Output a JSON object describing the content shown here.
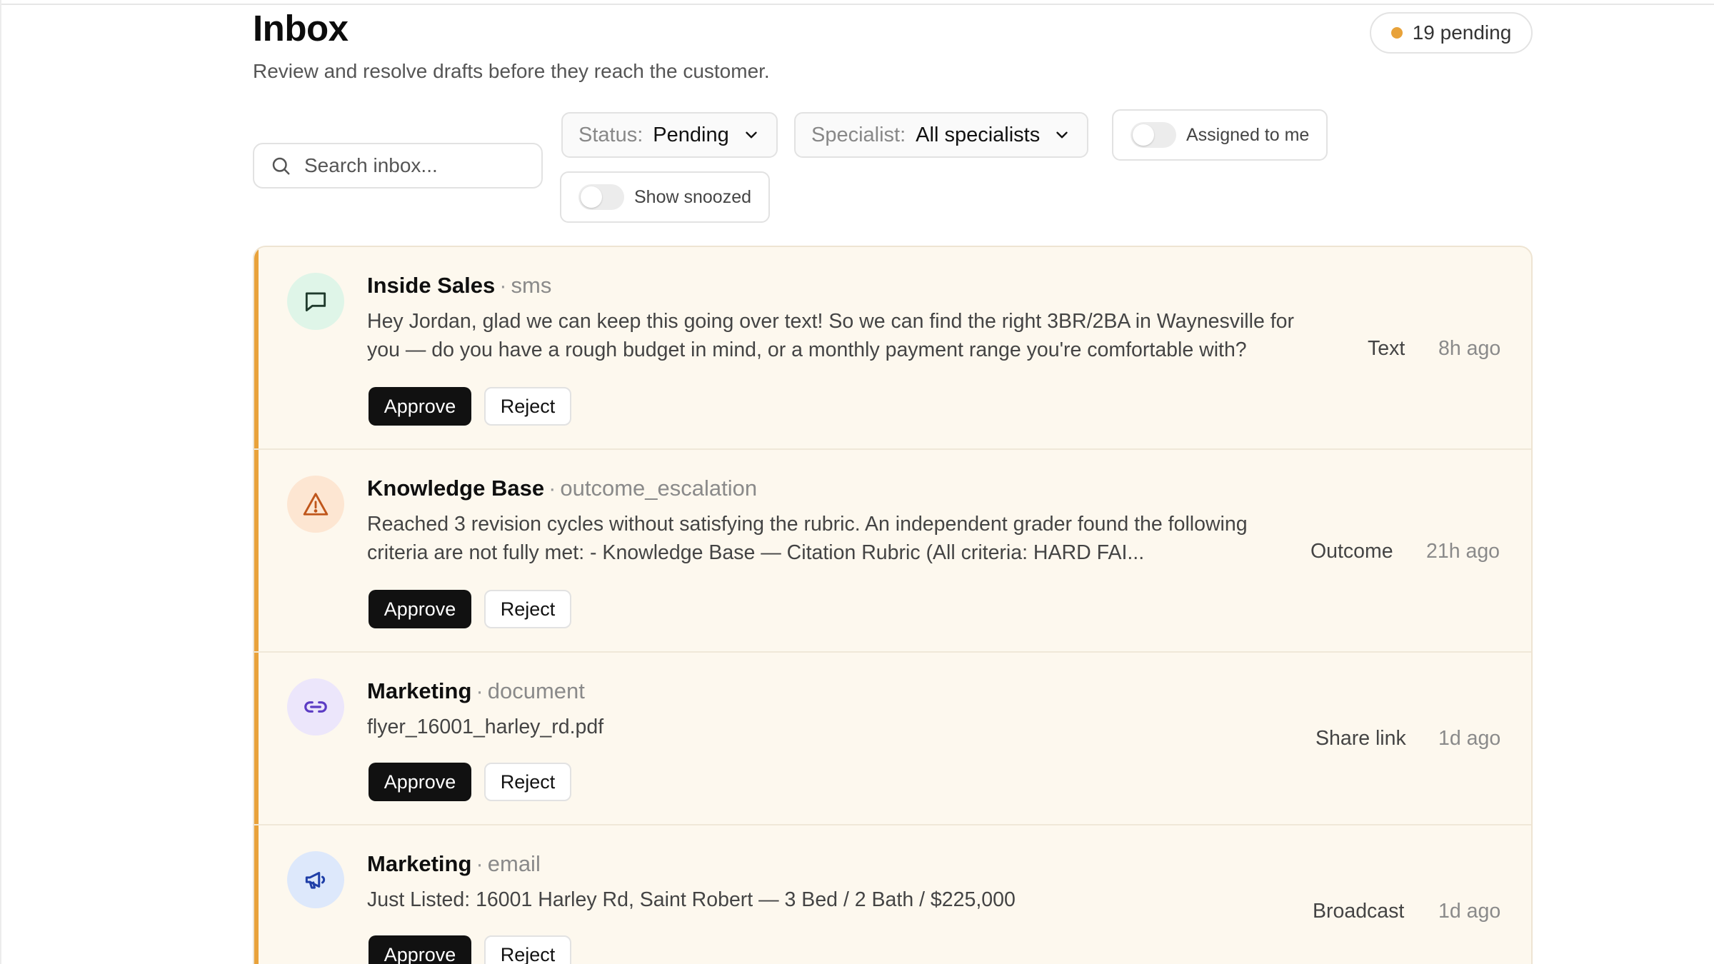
{
  "header": {
    "title": "Inbox",
    "subtitle": "Review and resolve drafts before they reach the customer.",
    "pending_badge": "19 pending",
    "pending_color": "#e8a23a"
  },
  "filters": {
    "search_placeholder": "Search inbox...",
    "status_label": "Status:",
    "status_value": "Pending",
    "specialist_label": "Specialist:",
    "specialist_value": "All specialists",
    "assigned_label": "Assigned to me",
    "snoozed_label": "Show snoozed"
  },
  "accent_color": "#e9a23b",
  "items": [
    {
      "icon": "message-square-icon",
      "name": "Inside Sales",
      "separator": "·",
      "kind": "sms",
      "body": "Hey Jordan, glad we can keep this going over text! So we can find the right 3BR/2BA in Waynesville for you — do you have a rough budget in mind, or a monthly payment range you're comfortable with?",
      "type": "Text",
      "time": "8h ago",
      "approve": "Approve",
      "reject": "Reject"
    },
    {
      "icon": "alert-triangle-icon",
      "name": "Knowledge Base",
      "separator": "·",
      "kind": "outcome_escalation",
      "body": "Reached 3 revision cycles without satisfying the rubric. An independent grader found the following criteria are not fully met: - Knowledge Base — Citation Rubric (All criteria: HARD FAI...",
      "type": "Outcome",
      "time": "21h ago",
      "approve": "Approve",
      "reject": "Reject"
    },
    {
      "icon": "link-icon",
      "name": "Marketing",
      "separator": "·",
      "kind": "document",
      "body": "flyer_16001_harley_rd.pdf",
      "type": "Share link",
      "time": "1d ago",
      "approve": "Approve",
      "reject": "Reject"
    },
    {
      "icon": "megaphone-icon",
      "name": "Marketing",
      "separator": "·",
      "kind": "email",
      "body": "Just Listed: 16001 Harley Rd, Saint Robert — 3 Bed / 2 Bath / $225,000",
      "type": "Broadcast",
      "time": "1d ago",
      "approve": "Approve",
      "reject": "Reject"
    }
  ]
}
